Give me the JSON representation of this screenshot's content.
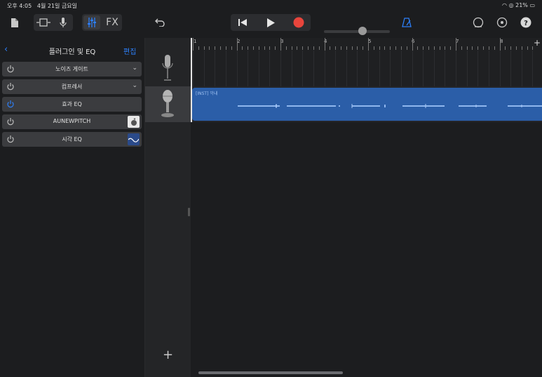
{
  "status": {
    "time": "오후 4:05",
    "date": "4월 21일 금요일",
    "battery": "21%"
  },
  "panel": {
    "title": "플러그인 및 EQ",
    "edit": "편집",
    "plugins": [
      {
        "label": "노이즈 게이트",
        "power_on": false,
        "has_chevron": true
      },
      {
        "label": "컴프레서",
        "power_on": false,
        "has_chevron": true
      },
      {
        "label": "효과 EQ",
        "power_on": true,
        "has_chevron": false
      },
      {
        "label": "AUNEWPITCH",
        "power_on": false,
        "has_chevron": false
      },
      {
        "label": "시각 EQ",
        "power_on": false,
        "has_chevron": false
      }
    ]
  },
  "toolbar": {
    "fx_label": "FX",
    "add_track": "+"
  },
  "ruler": {
    "bars": [
      "1",
      "2",
      "3",
      "4",
      "5",
      "6",
      "7",
      "8"
    ],
    "add_label": "+"
  },
  "region": {
    "name": "[INST] 악내"
  },
  "colors": {
    "accent": "#2d7ff9",
    "record": "#e8453c",
    "region": "#2b5ea8"
  }
}
